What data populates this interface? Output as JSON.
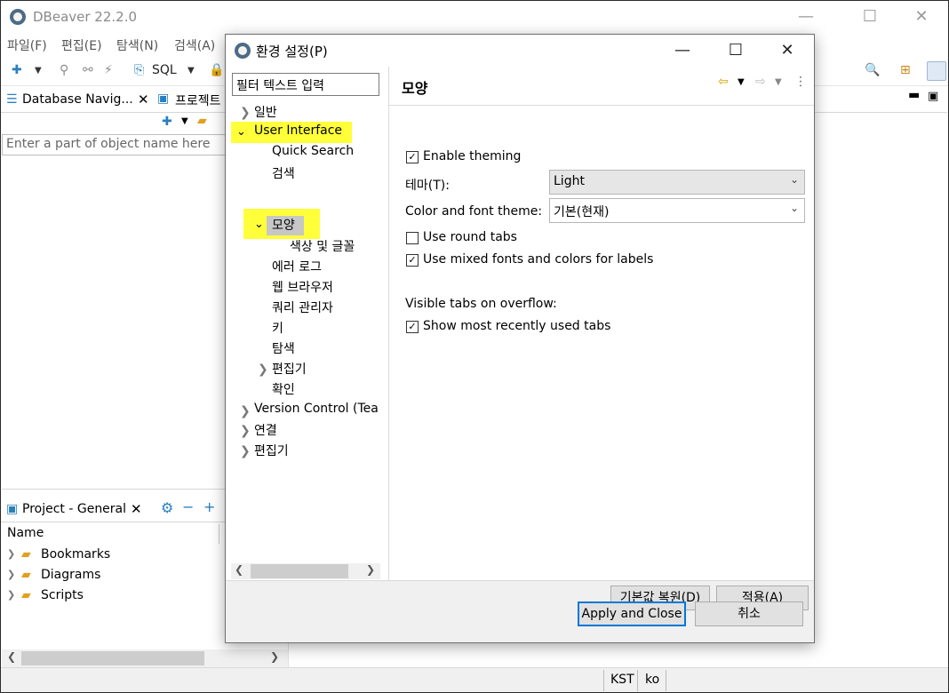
{
  "app": {
    "title": "DBeaver 22.2.0"
  },
  "menu": [
    "파일(F)",
    "편집(E)",
    "탐색(N)",
    "검색(A)"
  ],
  "toolbar": {
    "sql_label": "SQL"
  },
  "navigator": {
    "tab_label": "Database Navig...",
    "tab2_label": "프로젝트",
    "filter_placeholder": "Enter a part of object name here"
  },
  "project": {
    "tab_label": "Project - General",
    "column_name": "Name",
    "items": [
      "Bookmarks",
      "Diagrams",
      "Scripts"
    ]
  },
  "status": {
    "timezone": "KST",
    "locale": "ko"
  },
  "dialog": {
    "title": "환경 설정(P)",
    "filter_placeholder": "필터 텍스트 입력",
    "tree": {
      "general": "일반",
      "user_interface": "User Interface",
      "quick_search": "Quick Search",
      "search": "검색",
      "appearance": "모양",
      "colors_fonts": "색상 및 글꼴",
      "error_log": "에러 로그",
      "web_browser": "웹 브라우저",
      "query_manager": "쿼리 관리자",
      "keys": "키",
      "navigation": "탐색",
      "editors_sub": "편집기",
      "confirm": "확인",
      "version_control": "Version Control (Tea",
      "connections": "연결",
      "editors": "편집기"
    },
    "page": {
      "title": "모양",
      "enable_theming": "Enable theming",
      "enable_theming_checked": true,
      "theme_label": "테마(T):",
      "theme_value": "Light",
      "color_font_label": "Color and font theme:",
      "color_font_value": "기본(현재)",
      "round_tabs": "Use round tabs",
      "round_tabs_checked": false,
      "mixed_fonts": "Use mixed fonts and colors for labels",
      "mixed_fonts_checked": true,
      "visible_tabs_label": "Visible tabs on overflow:",
      "recent_tabs": "Show most recently used tabs",
      "recent_tabs_checked": true
    },
    "buttons": {
      "restore_defaults": "기본값 복원(D)",
      "apply": "적용(A)",
      "apply_close": "Apply and Close",
      "cancel": "취소"
    }
  },
  "colors": {
    "highlight": "#ffff3a",
    "accent": "#0078d7"
  }
}
